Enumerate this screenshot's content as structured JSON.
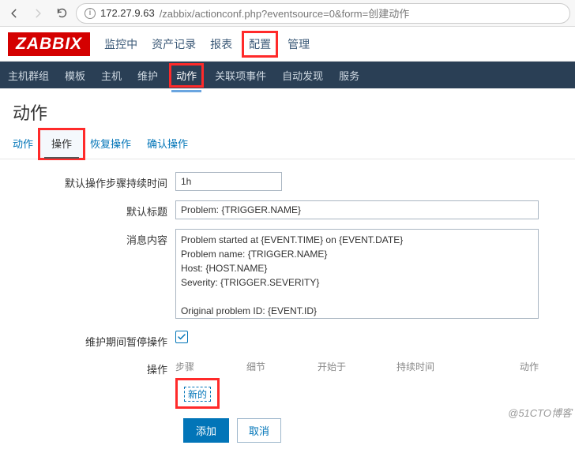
{
  "browser": {
    "url_host": "172.27.9.63",
    "url_path": "/zabbix/actionconf.php?eventsource=0&form=创建动作",
    "info_glyph": "i"
  },
  "logo_text": "ZABBIX",
  "top_menu": {
    "items": [
      "监控中",
      "资产记录",
      "报表",
      "配置",
      "管理"
    ],
    "highlighted_index": 3
  },
  "sub_nav": {
    "items": [
      "主机群组",
      "模板",
      "主机",
      "维护",
      "动作",
      "关联项事件",
      "自动发现",
      "服务"
    ],
    "active_index": 4,
    "highlighted_index": 4
  },
  "page_title": "动作",
  "tabs": {
    "items": [
      "动作",
      "操作",
      "恢复操作",
      "确认操作"
    ],
    "active_index": 1,
    "highlighted_index": 1
  },
  "form": {
    "default_step_duration": {
      "label": "默认操作步骤持续时间",
      "value": "1h"
    },
    "default_subject": {
      "label": "默认标题",
      "value": "Problem: {TRIGGER.NAME}"
    },
    "message_content": {
      "label": "消息内容",
      "value": "Problem started at {EVENT.TIME} on {EVENT.DATE}\nProblem name: {TRIGGER.NAME}\nHost: {HOST.NAME}\nSeverity: {TRIGGER.SEVERITY}\n\nOriginal problem ID: {EVENT.ID}\n{TRIGGER.URL}"
    },
    "pause_in_maintenance": {
      "label": "维护期间暂停操作",
      "checked": true
    },
    "operations": {
      "label": "操作",
      "columns": {
        "steps": "步骤",
        "detail": "细节",
        "start_at": "开始于",
        "duration": "持续时间",
        "action": "动作"
      },
      "new_label": "新的"
    },
    "buttons": {
      "add": "添加",
      "cancel": "取消"
    }
  },
  "watermark": "@51CTO博客"
}
